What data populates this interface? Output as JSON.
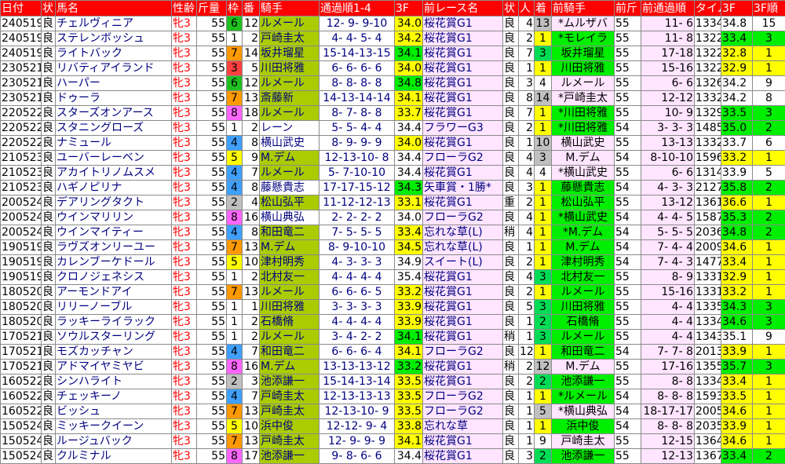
{
  "headers": {
    "date": "日付",
    "cond": "状",
    "name": "馬名",
    "sex": "性齢",
    "weight": "斤量",
    "waku": "枠",
    "ban": "番",
    "jockey": "騎手",
    "pass": "通過順1-4",
    "f3": "3F",
    "prev_race": "前レース名",
    "prev_cond": "状",
    "ninki": "人",
    "chaku": "着",
    "prev_jockey": "前騎手",
    "prev_weight": "前斤",
    "prev_pass": "前通過順",
    "time": "タイム",
    "prev_f3": "3F",
    "rank": "3F順"
  },
  "colors": {
    "header": "#ff0000",
    "waku": {
      "1": "#ffffff",
      "2": "#bfbfbf",
      "3": "#ff4040",
      "4": "#40a0ff",
      "5": "#ffff00",
      "6": "#20c020",
      "7": "#ff9900",
      "8": "#ff66ff"
    },
    "f3_good": "#ffff00",
    "f3_best": "#00ee00",
    "jockey_hl": "#aacc00",
    "prev_pink": "#ffe5ff",
    "chaku_gray": "#c0c0c0",
    "chaku_green": "#00dd55",
    "chaku_yellow": "#ffff00",
    "chaku_salmon": "#ffbfbf",
    "rank_green": "#00ee00",
    "rank_yellow": "#ffff00"
  },
  "rows": [
    {
      "date": "240519",
      "cond": "良",
      "name": "チェルヴィニア",
      "sex": "牝3",
      "weight": "55",
      "waku": "6",
      "ban": "12",
      "jockey": "ルメール",
      "jockey_hl": true,
      "pass": "12- 9- 9-10",
      "f3": "34.0",
      "f3_hl": "good",
      "prev": "桜花賞G1",
      "pcond": "良",
      "ninki": "4",
      "chaku": "13",
      "chaku_hl": "gray",
      "pjock": "*ムルザバ",
      "pwt": "55",
      "ppass": "11- 6",
      "time": "1334",
      "pf3": "34.8",
      "rank": "15",
      "rank_hl": ""
    },
    {
      "date": "240519",
      "cond": "良",
      "name": "ステレンボッシュ",
      "sex": "牝3",
      "weight": "55",
      "waku": "1",
      "ban": "2",
      "jockey": "戸崎圭太",
      "jockey_hl": true,
      "pass": "4- 4- 5- 4",
      "f3": "34.2",
      "f3_hl": "good",
      "prev": "桜花賞G1",
      "pcond": "良",
      "ninki": "2",
      "chaku": "1",
      "chaku_hl": "yellow",
      "pjock": "*モレイラ",
      "pwt": "55",
      "ppass": "11- 8",
      "time": "1322",
      "pf3": "33.4",
      "rank": "3",
      "rank_hl": "green"
    },
    {
      "date": "240519",
      "cond": "良",
      "name": "ライトバック",
      "sex": "牝3",
      "weight": "55",
      "waku": "7",
      "ban": "14",
      "jockey": "坂井瑠星",
      "jockey_hl": true,
      "pass": "15-14-13-15",
      "f3": "34.1",
      "f3_hl": "best",
      "prev": "桜花賞G1",
      "pcond": "良",
      "ninki": "7",
      "chaku": "3",
      "chaku_hl": "green",
      "pjock": "坂井瑠星",
      "pwt": "55",
      "ppass": "17-18",
      "time": "1322",
      "pf3": "32.8",
      "rank": "1",
      "rank_hl": "yellow"
    },
    {
      "date": "230521",
      "cond": "良",
      "name": "リバティアイランド",
      "sex": "牝3",
      "weight": "55",
      "waku": "3",
      "ban": "5",
      "jockey": "川田将雅",
      "jockey_hl": true,
      "pass": "6- 6- 6- 6",
      "f3": "34.0",
      "f3_hl": "good",
      "prev": "桜花賞G1",
      "pcond": "良",
      "ninki": "1",
      "chaku": "1",
      "chaku_hl": "yellow",
      "pjock": "川田将雅",
      "pwt": "55",
      "ppass": "15-16",
      "time": "1322",
      "pf3": "32.9",
      "rank": "1",
      "rank_hl": "yellow"
    },
    {
      "date": "230521",
      "cond": "良",
      "name": "ハーパー",
      "sex": "牝3",
      "weight": "55",
      "waku": "6",
      "ban": "12",
      "jockey": "ルメール",
      "jockey_hl": true,
      "pass": "8- 8- 8- 8",
      "f3": "34.8",
      "f3_hl": "best",
      "prev": "桜花賞G1",
      "pcond": "良",
      "ninki": "3",
      "chaku": "4",
      "chaku_hl": "",
      "pjock": "ルメール",
      "pwt": "55",
      "ppass": "6- 6",
      "time": "1326",
      "pf3": "34.2",
      "rank": "9",
      "rank_hl": ""
    },
    {
      "date": "230521",
      "cond": "良",
      "name": "ドゥーラ",
      "sex": "牝3",
      "weight": "55",
      "waku": "7",
      "ban": "13",
      "jockey": "斎藤新",
      "jockey_hl": true,
      "pass": "14-13-14-14",
      "f3": "34.1",
      "f3_hl": "good",
      "prev": "桜花賞G1",
      "pcond": "良",
      "ninki": "8",
      "chaku": "14",
      "chaku_hl": "gray",
      "pjock": "*戸崎圭太",
      "pwt": "55",
      "ppass": "12-12",
      "time": "1332",
      "pf3": "34.2",
      "rank": "8",
      "rank_hl": ""
    },
    {
      "date": "220522",
      "cond": "良",
      "name": "スターズオンアース",
      "sex": "牝3",
      "weight": "55",
      "waku": "8",
      "ban": "18",
      "jockey": "ルメール",
      "jockey_hl": true,
      "pass": "8- 7- 8- 8",
      "f3": "33.7",
      "f3_hl": "good",
      "prev": "桜花賞G1",
      "pcond": "良",
      "ninki": "7",
      "chaku": "1",
      "chaku_hl": "yellow",
      "pjock": "*川田将雅",
      "pwt": "55",
      "ppass": "10- 9",
      "time": "1329",
      "pf3": "33.5",
      "rank": "3",
      "rank_hl": "green"
    },
    {
      "date": "220522",
      "cond": "良",
      "name": "スタニングローズ",
      "sex": "牝3",
      "weight": "55",
      "waku": "1",
      "ban": "2",
      "jockey": "レーン",
      "jockey_hl": false,
      "pass": "5- 5- 4- 4",
      "f3": "34.4",
      "f3_hl": "",
      "prev": "フラワーG3",
      "pcond": "良",
      "ninki": "2",
      "chaku": "1",
      "chaku_hl": "yellow",
      "pjock": "*川田将雅",
      "pwt": "54",
      "ppass": "3- 3- 3",
      "time": "1485",
      "pf3": "35.0",
      "rank": "2",
      "rank_hl": "green"
    },
    {
      "date": "220522",
      "cond": "良",
      "name": "ナミュール",
      "sex": "牝3",
      "weight": "55",
      "waku": "4",
      "ban": "8",
      "jockey": "横山武史",
      "jockey_hl": false,
      "pass": "8- 9- 9- 9",
      "f3": "34.0",
      "f3_hl": "good",
      "prev": "桜花賞G1",
      "pcond": "良",
      "ninki": "1",
      "chaku": "10",
      "chaku_hl": "gray",
      "pjock": "横山武史",
      "pwt": "55",
      "ppass": "13-13",
      "time": "1332",
      "pf3": "33.7",
      "rank": "6",
      "rank_hl": ""
    },
    {
      "date": "210523",
      "cond": "良",
      "name": "ユーバーレーベン",
      "sex": "牝3",
      "weight": "55",
      "waku": "5",
      "ban": "9",
      "jockey": "M.デム",
      "jockey_hl": true,
      "pass": "12-13-10- 8",
      "f3": "34.4",
      "f3_hl": "",
      "prev": "フローラG2",
      "pcond": "良",
      "ninki": "4",
      "chaku": "3",
      "chaku_hl": "gray",
      "pjock": "M.デム",
      "pwt": "54",
      "ppass": "8-10-10",
      "time": "1596",
      "pf3": "33.2",
      "rank": "1",
      "rank_hl": "yellow"
    },
    {
      "date": "210523",
      "cond": "良",
      "name": "アカイトリノムスメ",
      "sex": "牝3",
      "weight": "55",
      "waku": "4",
      "ban": "7",
      "jockey": "ルメール",
      "jockey_hl": true,
      "pass": "5- 7-10-10",
      "f3": "34.4",
      "f3_hl": "",
      "prev": "桜花賞G1",
      "pcond": "良",
      "ninki": "4",
      "chaku": "4",
      "chaku_hl": "",
      "pjock": "*横山武史",
      "pwt": "55",
      "ppass": "6- 6",
      "time": "1314",
      "pf3": "33.9",
      "rank": "5",
      "rank_hl": ""
    },
    {
      "date": "210523",
      "cond": "良",
      "name": "ハギノピリナ",
      "sex": "牝3",
      "weight": "55",
      "waku": "4",
      "ban": "8",
      "jockey": "藤懸貴志",
      "jockey_hl": false,
      "pass": "17-17-15-12",
      "f3": "34.3",
      "f3_hl": "best",
      "prev": "矢車賞・1勝*",
      "pcond": "良",
      "ninki": "3",
      "chaku": "1",
      "chaku_hl": "yellow",
      "pjock": "藤懸貴志",
      "pwt": "54",
      "ppass": "4- 3- 3",
      "time": "2127",
      "pf3": "35.8",
      "rank": "2",
      "rank_hl": "green"
    },
    {
      "date": "200524",
      "cond": "良",
      "name": "デアリングタクト",
      "sex": "牝3",
      "weight": "55",
      "waku": "2",
      "ban": "4",
      "jockey": "松山弘平",
      "jockey_hl": true,
      "pass": "11-12-12-13",
      "f3": "33.1",
      "f3_hl": "good",
      "prev": "桜花賞G1",
      "pcond": "重",
      "ninki": "2",
      "chaku": "1",
      "chaku_hl": "yellow",
      "pjock": "松山弘平",
      "pwt": "55",
      "ppass": "13-12",
      "time": "1361",
      "pf3": "36.6",
      "rank": "1",
      "rank_hl": "yellow"
    },
    {
      "date": "200524",
      "cond": "良",
      "name": "ウインマリリン",
      "sex": "牝3",
      "weight": "55",
      "waku": "8",
      "ban": "16",
      "jockey": "横山典弘",
      "jockey_hl": false,
      "pass": "2- 2- 2- 2",
      "f3": "34.0",
      "f3_hl": "",
      "prev": "フローラG2",
      "pcond": "良",
      "ninki": "4",
      "chaku": "1",
      "chaku_hl": "yellow",
      "pjock": "*横山武史",
      "pwt": "54",
      "ppass": "4- 4- 5",
      "time": "1587",
      "pf3": "35.3",
      "rank": "2",
      "rank_hl": "green"
    },
    {
      "date": "200524",
      "cond": "良",
      "name": "ウインマイティー",
      "sex": "牝3",
      "weight": "55",
      "waku": "4",
      "ban": "8",
      "jockey": "和田竜二",
      "jockey_hl": true,
      "pass": "7- 5- 5- 5",
      "f3": "33.4",
      "f3_hl": "good",
      "prev": "忘れな草(L)",
      "pcond": "稍",
      "ninki": "4",
      "chaku": "1",
      "chaku_hl": "yellow",
      "pjock": "*M.デム",
      "pwt": "54",
      "ppass": "5- 5- 5",
      "time": "2036",
      "pf3": "34.8",
      "rank": "2",
      "rank_hl": "green"
    },
    {
      "date": "190519",
      "cond": "良",
      "name": "ラヴズオンリーユー",
      "sex": "牝3",
      "weight": "55",
      "waku": "7",
      "ban": "13",
      "jockey": "M.デム",
      "jockey_hl": true,
      "pass": "8- 9-10-10",
      "f3": "34.5",
      "f3_hl": "good",
      "prev": "忘れな草(L)",
      "pcond": "良",
      "ninki": "1",
      "chaku": "1",
      "chaku_hl": "yellow",
      "pjock": "M.デム",
      "pwt": "54",
      "ppass": "7- 4- 4",
      "time": "2009",
      "pf3": "34.6",
      "rank": "1",
      "rank_hl": "yellow"
    },
    {
      "date": "190519",
      "cond": "良",
      "name": "カレンブーケドール",
      "sex": "牝3",
      "weight": "55",
      "waku": "5",
      "ban": "10",
      "jockey": "津村明秀",
      "jockey_hl": true,
      "pass": "4- 3- 3- 3",
      "f3": "34.9",
      "f3_hl": "",
      "prev": "スイート(L)",
      "pcond": "良",
      "ninki": "2",
      "chaku": "1",
      "chaku_hl": "yellow",
      "pjock": "津村明秀",
      "pwt": "54",
      "ppass": "7- 4- 3",
      "time": "1477",
      "pf3": "33.4",
      "rank": "1",
      "rank_hl": "yellow"
    },
    {
      "date": "190519",
      "cond": "良",
      "name": "クロノジェネシス",
      "sex": "牝3",
      "weight": "55",
      "waku": "1",
      "ban": "2",
      "jockey": "北村友一",
      "jockey_hl": true,
      "pass": "4- 4- 4- 4",
      "f3": "35.4",
      "f3_hl": "",
      "prev": "桜花賞G1",
      "pcond": "良",
      "ninki": "4",
      "chaku": "3",
      "chaku_hl": "green",
      "pjock": "北村友一",
      "pwt": "55",
      "ppass": "8- 9",
      "time": "1331",
      "pf3": "32.9",
      "rank": "1",
      "rank_hl": "yellow"
    },
    {
      "date": "180520",
      "cond": "良",
      "name": "アーモンドアイ",
      "sex": "牝3",
      "weight": "55",
      "waku": "7",
      "ban": "13",
      "jockey": "ルメール",
      "jockey_hl": true,
      "pass": "6- 6- 6- 5",
      "f3": "33.2",
      "f3_hl": "good",
      "prev": "桜花賞G1",
      "pcond": "良",
      "ninki": "2",
      "chaku": "1",
      "chaku_hl": "yellow",
      "pjock": "ルメール",
      "pwt": "55",
      "ppass": "15-16",
      "time": "1331",
      "pf3": "33.2",
      "rank": "1",
      "rank_hl": "yellow"
    },
    {
      "date": "180520",
      "cond": "良",
      "name": "リリーノーブル",
      "sex": "牝3",
      "weight": "55",
      "waku": "1",
      "ban": "1",
      "jockey": "川田将雅",
      "jockey_hl": true,
      "pass": "3- 3- 3- 3",
      "f3": "33.9",
      "f3_hl": "good",
      "prev": "桜花賞G1",
      "pcond": "良",
      "ninki": "5",
      "chaku": "3",
      "chaku_hl": "green",
      "pjock": "川田将雅",
      "pwt": "55",
      "ppass": "4- 4",
      "time": "1335",
      "pf3": "34.3",
      "rank": "3",
      "rank_hl": "green"
    },
    {
      "date": "180520",
      "cond": "良",
      "name": "ラッキーライラック",
      "sex": "牝3",
      "weight": "55",
      "waku": "1",
      "ban": "2",
      "jockey": "石橋脩",
      "jockey_hl": true,
      "pass": "4- 4- 4- 4",
      "f3": "33.9",
      "f3_hl": "good",
      "prev": "桜花賞G1",
      "pcond": "良",
      "ninki": "1",
      "chaku": "2",
      "chaku_hl": "green",
      "pjock": "石橋脩",
      "pwt": "55",
      "ppass": "4- 4",
      "time": "1334",
      "pf3": "34.6",
      "rank": "3",
      "rank_hl": "green"
    },
    {
      "date": "170521",
      "cond": "良",
      "name": "ソウルスターリング",
      "sex": "牝3",
      "weight": "55",
      "waku": "1",
      "ban": "2",
      "jockey": "ルメール",
      "jockey_hl": true,
      "pass": "3- 4- 2- 2",
      "f3": "34.1",
      "f3_hl": "best",
      "prev": "桜花賞G1",
      "pcond": "稍",
      "ninki": "1",
      "chaku": "3",
      "chaku_hl": "green",
      "pjock": "ルメール",
      "pwt": "55",
      "ppass": "4- 4",
      "time": "1343",
      "pf3": "35.1",
      "rank": "9",
      "rank_hl": ""
    },
    {
      "date": "170521",
      "cond": "良",
      "name": "モズカッチャン",
      "sex": "牝3",
      "weight": "55",
      "waku": "4",
      "ban": "7",
      "jockey": "和田竜二",
      "jockey_hl": true,
      "pass": "6- 6- 6- 4",
      "f3": "34.1",
      "f3_hl": "good",
      "prev": "フローラG2",
      "pcond": "良",
      "ninki": "12",
      "chaku": "1",
      "chaku_hl": "yellow",
      "pjock": "和田竜二",
      "pwt": "54",
      "ppass": "7- 7- 8",
      "time": "2013",
      "pf3": "33.9",
      "rank": "1",
      "rank_hl": "yellow"
    },
    {
      "date": "170521",
      "cond": "良",
      "name": "アドマイヤミヤビ",
      "sex": "牝3",
      "weight": "55",
      "waku": "8",
      "ban": "16",
      "jockey": "M.デム",
      "jockey_hl": true,
      "pass": "13-13-13-12",
      "f3": "33.2",
      "f3_hl": "best",
      "prev": "桜花賞G1",
      "pcond": "稍",
      "ninki": "2",
      "chaku": "12",
      "chaku_hl": "gray",
      "pjock": "M.デム",
      "pwt": "55",
      "ppass": "17-16",
      "time": "1355",
      "pf3": "35.7",
      "rank": "3",
      "rank_hl": "green"
    },
    {
      "date": "160522",
      "cond": "良",
      "name": "シンハライト",
      "sex": "牝3",
      "weight": "55",
      "waku": "2",
      "ban": "3",
      "jockey": "池添謙一",
      "jockey_hl": true,
      "pass": "15-14-13-14",
      "f3": "33.5",
      "f3_hl": "good",
      "prev": "桜花賞G1",
      "pcond": "良",
      "ninki": "2",
      "chaku": "2",
      "chaku_hl": "green",
      "pjock": "池添謙一",
      "pwt": "55",
      "ppass": "8- 8",
      "time": "1334",
      "pf3": "33.4",
      "rank": "1",
      "rank_hl": "yellow"
    },
    {
      "date": "160522",
      "cond": "良",
      "name": "チェッキーノ",
      "sex": "牝3",
      "weight": "55",
      "waku": "4",
      "ban": "7",
      "jockey": "戸崎圭太",
      "jockey_hl": true,
      "pass": "12-13-13-13",
      "f3": "33.5",
      "f3_hl": "good",
      "prev": "フローラG2",
      "pcond": "良",
      "ninki": "1",
      "chaku": "1",
      "chaku_hl": "yellow",
      "pjock": "*ルメール",
      "pwt": "54",
      "ppass": "8- 8- 8",
      "time": "1593",
      "pf3": "33.5",
      "rank": "1",
      "rank_hl": "yellow"
    },
    {
      "date": "160522",
      "cond": "良",
      "name": "ビッシュ",
      "sex": "牝3",
      "weight": "55",
      "waku": "7",
      "ban": "13",
      "jockey": "戸崎圭太",
      "jockey_hl": true,
      "pass": "12-13-10- 9",
      "f3": "33.5",
      "f3_hl": "good",
      "prev": "フローラG2",
      "pcond": "良",
      "ninki": "1",
      "chaku": "5",
      "chaku_hl": "gray",
      "pjock": "*横山典弘",
      "pwt": "54",
      "ppass": "18-17-17",
      "time": "2005",
      "pf3": "34.6",
      "rank": "1",
      "rank_hl": "yellow"
    },
    {
      "date": "150524",
      "cond": "良",
      "name": "ミッキークイーン",
      "sex": "牝3",
      "weight": "55",
      "waku": "5",
      "ban": "10",
      "jockey": "浜中俊",
      "jockey_hl": true,
      "pass": "12-12- 9- 4",
      "f3": "33.8",
      "f3_hl": "good",
      "prev": "忘れな草",
      "pcond": "良",
      "ninki": "1",
      "chaku": "1",
      "chaku_hl": "yellow",
      "pjock": "浜中俊",
      "pwt": "54",
      "ppass": "8- 8- 8",
      "time": "2035",
      "pf3": "33.9",
      "rank": "1",
      "rank_hl": "yellow"
    },
    {
      "date": "150524",
      "cond": "良",
      "name": "ルージュバック",
      "sex": "牝3",
      "weight": "55",
      "waku": "7",
      "ban": "13",
      "jockey": "戸崎圭太",
      "jockey_hl": true,
      "pass": "12- 9- 9- 9",
      "f3": "34.1",
      "f3_hl": "good",
      "prev": "桜花賞G1",
      "pcond": "良",
      "ninki": "1",
      "chaku": "9",
      "chaku_hl": "",
      "pjock": "戸崎圭太",
      "pwt": "55",
      "ppass": "12-15",
      "time": "1364",
      "pf3": "34.6",
      "rank": "1",
      "rank_hl": "yellow"
    },
    {
      "date": "150524",
      "cond": "良",
      "name": "クルミナル",
      "sex": "牝3",
      "weight": "55",
      "waku": "8",
      "ban": "17",
      "jockey": "池添謙一",
      "jockey_hl": true,
      "pass": "9- 8- 6- 6",
      "f3": "34.4",
      "f3_hl": "",
      "prev": "桜花賞G1",
      "pcond": "良",
      "ninki": "3",
      "chaku": "2",
      "chaku_hl": "green",
      "pjock": "池添謙一",
      "pwt": "55",
      "ppass": "12-13",
      "time": "1367",
      "pf3": "33.4",
      "rank": "2",
      "rank_hl": "green"
    }
  ]
}
